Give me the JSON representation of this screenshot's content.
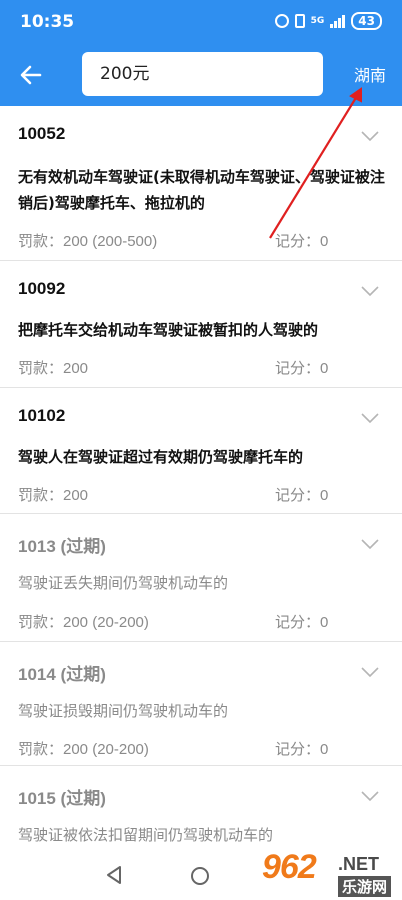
{
  "status": {
    "time": "10:35",
    "battery": "43",
    "network": "5G"
  },
  "toolbar": {
    "search_value": "200元",
    "region": "湖南"
  },
  "items": [
    {
      "code": "10052",
      "desc": "无有效机动车驾驶证(未取得机动车驾驶证、驾驶证被注销后)驾驶摩托车、拖拉机的",
      "fine": "罚款：200 (200-500)",
      "points": "记分：0"
    },
    {
      "code": "10092",
      "desc": "把摩托车交给机动车驾驶证被暂扣的人驾驶的",
      "fine": "罚款：200",
      "points": "记分：0"
    },
    {
      "code": "10102",
      "desc": "驾驶人在驾驶证超过有效期仍驾驶摩托车的",
      "fine": "罚款：200",
      "points": "记分：0"
    },
    {
      "code": "1013 (过期)",
      "desc": "驾驶证丢失期间仍驾驶机动车的",
      "fine": "罚款：200 (20-200)",
      "points": "记分：0"
    },
    {
      "code": "1014 (过期)",
      "desc": "驾驶证损毁期间仍驾驶机动车的",
      "fine": "罚款：200 (20-200)",
      "points": "记分：0"
    },
    {
      "code": "1015 (过期)",
      "desc": "驾驶证被依法扣留期间仍驾驶机动车的",
      "fine": "",
      "points": ""
    }
  ],
  "watermark": {
    "number": "962",
    "suffix": ".NET",
    "site": "乐游网"
  },
  "colors": {
    "primary": "#2f8ff0",
    "arrow": "#e02020",
    "watermark": "#f07a1a"
  }
}
